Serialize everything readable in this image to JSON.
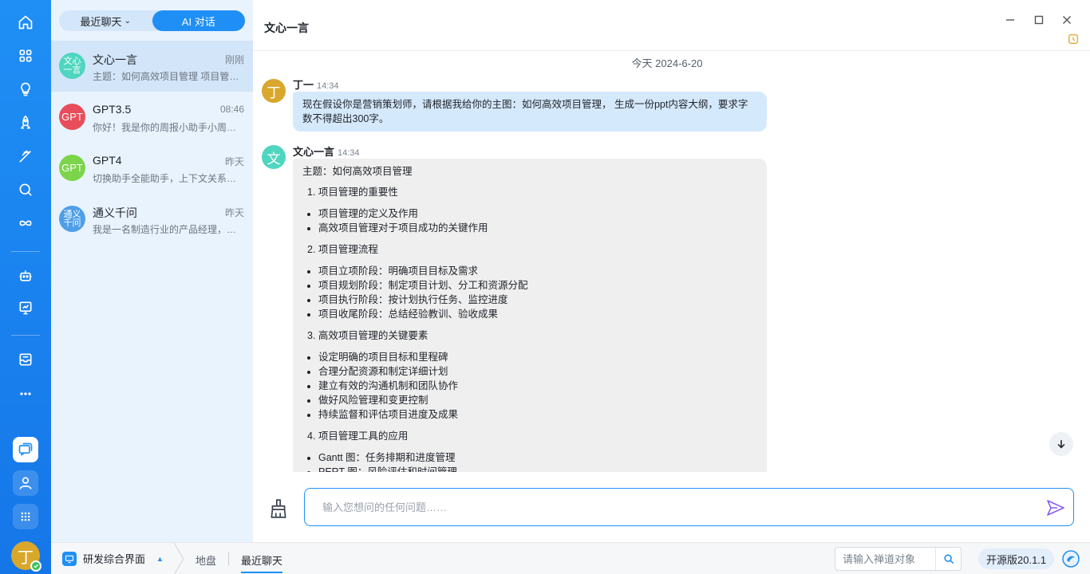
{
  "nav": {
    "items": [
      "home-icon",
      "apps-grid-icon",
      "lightbulb-icon",
      "rocket-icon",
      "pen-icon",
      "search-icon",
      "infinity-icon",
      "robot-icon",
      "chart-icon",
      "inbox-icon",
      "more-icon",
      "chat-icon",
      "user-icon",
      "dots-grid-icon"
    ],
    "avatar_char": "丁",
    "accent": "#1f8ff5"
  },
  "sidebar": {
    "tabs": {
      "recent": "最近聊天",
      "ai": "AI 对话"
    },
    "conversations": [
      {
        "avatar_text": "文心一言",
        "avatar_color": "#4fd6c0",
        "name": "文心一言",
        "time": "刚刚",
        "preview": "主题：如何高效项目管理 项目管理的重要性"
      },
      {
        "avatar_text": "GPT",
        "avatar_color": "#e84d5b",
        "name": "GPT3.5",
        "time": "08:46",
        "preview": "你好！我是你的周报小助手小周，有什么可以帮您"
      },
      {
        "avatar_text": "GPT",
        "avatar_color": "#7bd44a",
        "name": "GPT4",
        "time": "昨天",
        "preview": "切换助手全能助手，上下文关系已清除"
      },
      {
        "avatar_text": "通义千问",
        "avatar_color": "#4f9ee8",
        "name": "通义千问",
        "time": "昨天",
        "preview": "我是一名制造行业的产品经理，帮我写一份"
      }
    ]
  },
  "chat": {
    "title": "文心一言",
    "date": "今天 2024-6-20",
    "user_msg": {
      "avatar_char": "丁",
      "sender": "丁一",
      "time": "14:34",
      "text": "现在假设你是营销策划师，请根据我给你的主图：如何高效项目管理， 生成一份ppt内容大纲，要求字数不得超出300字。"
    },
    "ai_msg": {
      "avatar_char": "文",
      "sender": "文心一言",
      "time": "14:34",
      "intro": "主题：如何高效项目管理",
      "sections": [
        {
          "title": "1. 项目管理的重要性",
          "items": [
            "项目管理的定义及作用",
            "高效项目管理对于项目成功的关键作用"
          ]
        },
        {
          "title": "2. 项目管理流程",
          "items": [
            "项目立项阶段：明确项目目标及需求",
            "项目规划阶段：制定项目计划、分工和资源分配",
            "项目执行阶段：按计划执行任务、监控进度",
            "项目收尾阶段：总结经验教训、验收成果"
          ]
        },
        {
          "title": "3. 高效项目管理的关键要素",
          "items": [
            "设定明确的项目目标和里程碑",
            "合理分配资源和制定详细计划",
            "建立有效的沟通机制和团队协作",
            "做好风险管理和变更控制",
            "持续监督和评估项目进度及成果"
          ]
        },
        {
          "title": "4. 项目管理工具的应用",
          "items": [
            "Gantt 图：任务排期和进度管理",
            "PERT 图：风险评估和时间管理"
          ]
        }
      ]
    },
    "input_placeholder": "输入您想问的任何问题……"
  },
  "statusbar": {
    "app": "研发综合界面",
    "crumbs": [
      "地盘",
      "最近聊天"
    ],
    "search_placeholder": "请输入禅道对象",
    "version": "开源版20.1.1"
  }
}
